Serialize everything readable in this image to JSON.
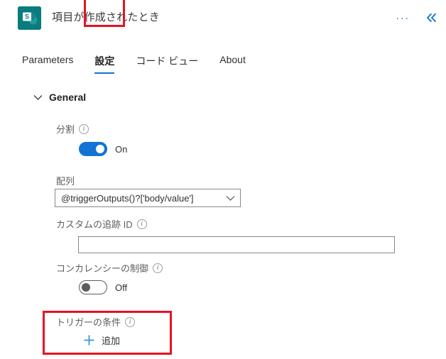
{
  "header": {
    "app_icon": "sharepoint-icon",
    "title": "項目が作成されたとき",
    "more_label": "···",
    "collapse_label": "«",
    "icon_color": "#0a7b7e",
    "accent_color": "#1273d4"
  },
  "tabs": [
    {
      "label": "Parameters",
      "active": false
    },
    {
      "label": "設定",
      "active": true
    },
    {
      "label": "コード ビュー",
      "active": false
    },
    {
      "label": "About",
      "active": false
    }
  ],
  "highlight": {
    "color": "#e81123"
  },
  "general": {
    "section_label": "General",
    "split": {
      "label": "分割",
      "state_label": "On",
      "on": true
    },
    "array": {
      "label": "配列",
      "value": "@triggerOutputs()?['body/value']"
    },
    "custom_tracking_id": {
      "label": "カスタムの追跡 ID",
      "value": "",
      "placeholder": ""
    },
    "concurrency": {
      "label": "コンカレンシーの制御",
      "state_label": "Off",
      "on": false
    },
    "trigger_condition": {
      "label": "トリガーの条件",
      "add_label": "追加"
    }
  }
}
